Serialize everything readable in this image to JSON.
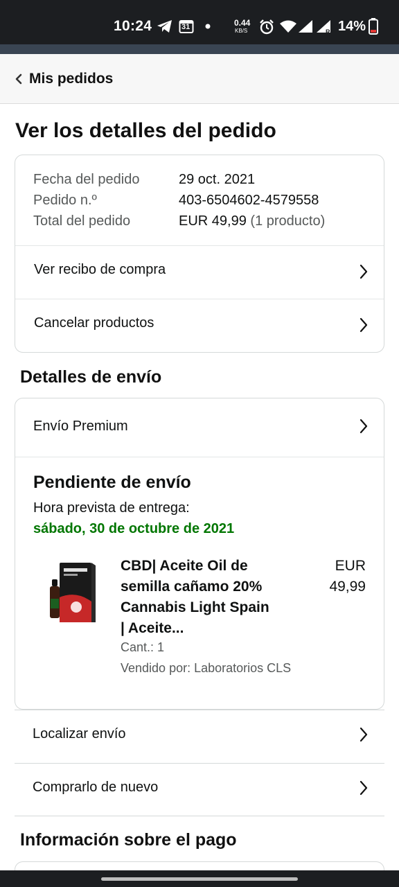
{
  "status_bar": {
    "time": "10:24",
    "calendar_day": "31",
    "net_speed_value": "0.44",
    "net_speed_unit": "KB/S",
    "battery": "14%",
    "icons": [
      "telegram-icon",
      "calendar-icon",
      "dot-icon",
      "alarm-icon",
      "wifi-icon",
      "signal-icon",
      "signal-r-icon",
      "battery-icon"
    ]
  },
  "nav": {
    "back_label": "Mis pedidos"
  },
  "page_title": "Ver los detalles del pedido",
  "order_summary": {
    "date_label": "Fecha del pedido",
    "date_value": "29 oct. 2021",
    "number_label": "Pedido n.º",
    "number_value": "403-6504602-4579558",
    "total_label": "Total del pedido",
    "total_value": "EUR 49,99",
    "total_count": "(1 producto)"
  },
  "order_actions": {
    "receipt": "Ver recibo de compra",
    "cancel": "Cancelar productos"
  },
  "shipping": {
    "section_title": "Detalles de envío",
    "method": "Envío Premium",
    "status": "Pendiente de envío",
    "eta_label": "Hora prevista de entrega:",
    "eta_date": "sábado, 30 de octubre de 2021",
    "product": {
      "title_lines": [
        "CBD| Aceite Oil de",
        "semilla cañamo 20%",
        "Cannabis Light Spain",
        "| Aceite..."
      ],
      "qty": "Cant.: 1",
      "seller": "Vendido por: Laboratorios CLS",
      "price_currency": "EUR",
      "price_amount": "49,99"
    },
    "track": "Localizar envío",
    "buy_again": "Comprarlo de nuevo"
  },
  "payment": {
    "section_title": "Información sobre el pago"
  },
  "colors": {
    "status_bar": "#1c1e21",
    "accent_bar": "#3a4553",
    "green_eta": "#007600",
    "muted_text": "#565959",
    "border": "#d5d9d9"
  }
}
